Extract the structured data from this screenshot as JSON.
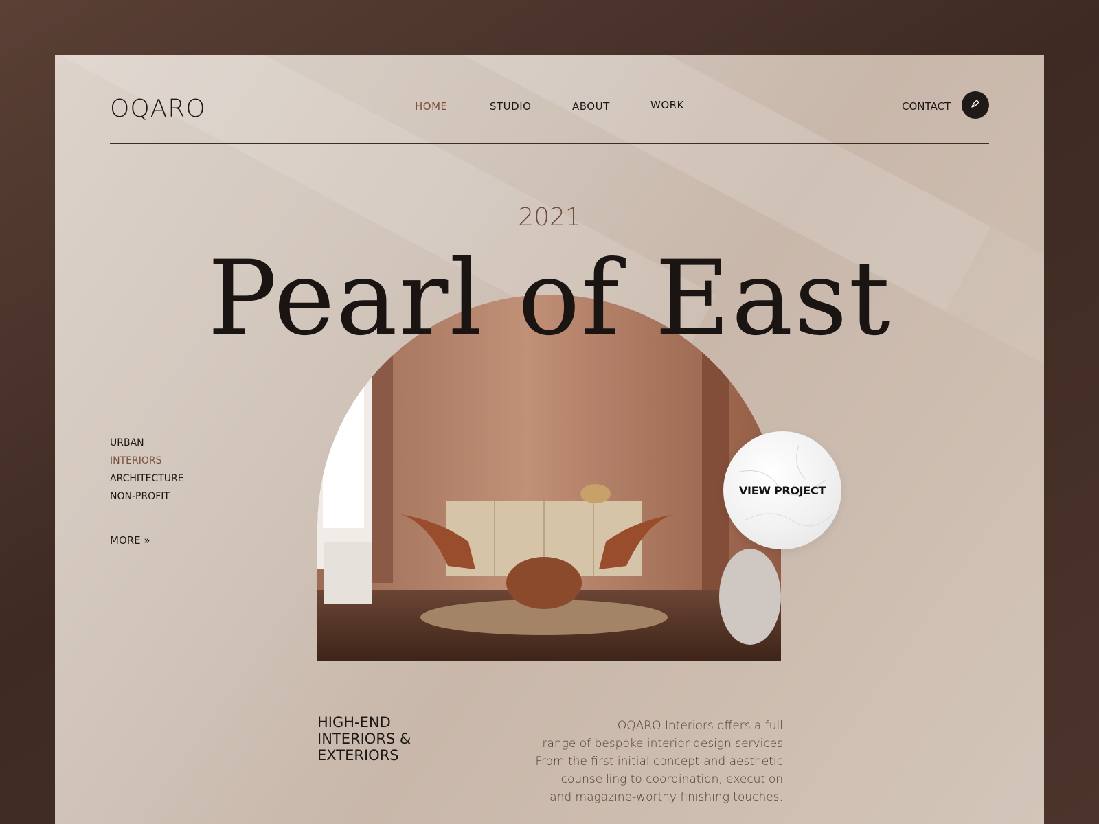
{
  "header": {
    "logo": "OQARO",
    "nav": [
      {
        "label": "HOME",
        "active": true
      },
      {
        "label": "STUDIO",
        "active": false
      },
      {
        "label": "ABOUT",
        "active": false
      },
      {
        "label": "WORK",
        "active": false
      }
    ],
    "contact_label": "CONTACT",
    "contact_icon": "pen-nib-icon"
  },
  "hero": {
    "year": "2021",
    "title": "Pearl of East",
    "cta_label": "VIEW PROJECT"
  },
  "side_nav": {
    "items": [
      {
        "label": "URBAN",
        "active": false
      },
      {
        "label": "INTERIORS",
        "active": true
      },
      {
        "label": "ARCHITECTURE",
        "active": false
      },
      {
        "label": "NON-PROFIT",
        "active": false
      }
    ],
    "more_label": "MORE »"
  },
  "intro": {
    "tagline_lines": [
      "HIGH-END",
      "INTERIORS &",
      "EXTERIORS"
    ],
    "description_lines": [
      "OQARO Interiors offers a full",
      "range of bespoke interior design services",
      "From the first initial concept and aesthetic",
      "counselling to coordination, execution",
      "and magazine-worthy finishing touches."
    ]
  },
  "colors": {
    "accent": "#7a4e3e",
    "text": "#1e1815",
    "frame": "#4a332b"
  }
}
